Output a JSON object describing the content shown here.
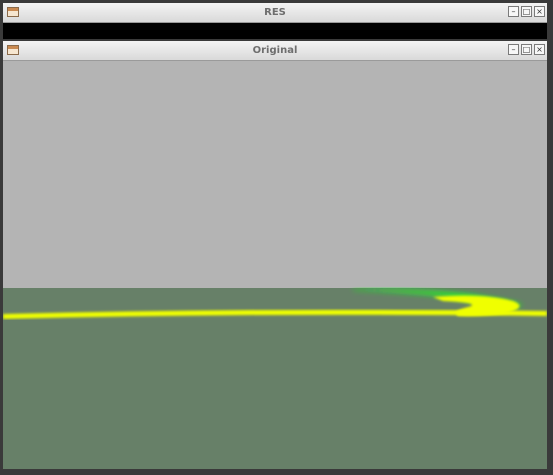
{
  "windows": {
    "res": {
      "title": "RES",
      "controls": {
        "minimize": "–",
        "maximize": "□",
        "close": "×"
      },
      "icon": "window-icon"
    },
    "original": {
      "title": "Original",
      "controls": {
        "minimize": "–",
        "maximize": "□",
        "close": "×"
      },
      "icon": "window-icon"
    }
  },
  "scene": {
    "colors": {
      "sky": "#b4b4b4",
      "ground": "#678068",
      "lane_line": "#f0ff00",
      "lane_highlight": "#19ff1a"
    }
  }
}
